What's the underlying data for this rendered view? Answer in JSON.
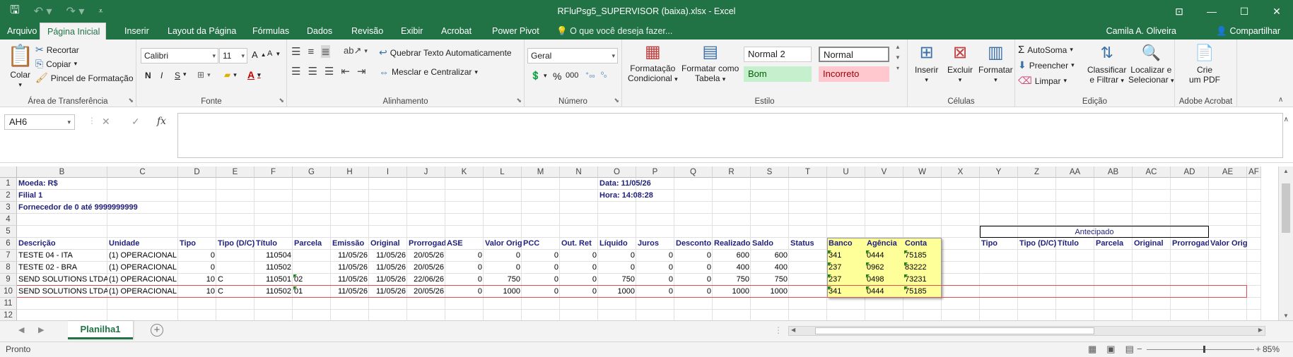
{
  "window": {
    "title": "RFluPsg5_SUPERVISOR (baixa).xlsx - Excel"
  },
  "qat": {
    "save_icon": "save-icon",
    "undo_icon": "undo-icon",
    "redo_icon": "redo-icon",
    "customize_icon": "customize-qat-icon"
  },
  "tabs": [
    "Arquivo",
    "Página Inicial",
    "Inserir",
    "Layout da Página",
    "Fórmulas",
    "Dados",
    "Revisão",
    "Exibir",
    "Acrobat",
    "Power Pivot"
  ],
  "active_tab": "Página Inicial",
  "tell_me": "O que você deseja fazer...",
  "user": "Camila A. Oliveira",
  "share": "Compartilhar",
  "ribbon": {
    "clipboard": {
      "label": "Área de Transferência",
      "paste": "Colar",
      "cut": "Recortar",
      "copy": "Copiar",
      "painter": "Pincel de Formatação"
    },
    "font": {
      "label": "Fonte",
      "name": "Calibri",
      "size": "11",
      "bold": "N",
      "italic": "I",
      "underline": "S"
    },
    "align": {
      "label": "Alinhamento",
      "wrap": "Quebrar Texto Automaticamente",
      "merge": "Mesclar e Centralizar"
    },
    "number": {
      "label": "Número",
      "format": "Geral",
      "percent": "%",
      "thousands": "000"
    },
    "styles": {
      "label": "Estilo",
      "conditional_l1": "Formatação",
      "conditional_l2": "Condicional",
      "table_l1": "Formatar como",
      "table_l2": "Tabela",
      "normal2": "Normal 2",
      "normal": "Normal",
      "good": "Bom",
      "bad": "Incorreto"
    },
    "cells": {
      "label": "Células",
      "insert": "Inserir",
      "delete": "Excluir",
      "format": "Formatar"
    },
    "editing": {
      "label": "Edição",
      "autosum": "AutoSoma",
      "fill": "Preencher",
      "clear": "Limpar",
      "sort_l1": "Classificar",
      "sort_l2": "e Filtrar",
      "find_l1": "Localizar e",
      "find_l2": "Selecionar"
    },
    "acrobat": {
      "label": "Adobe Acrobat",
      "pdf_l1": "Crie",
      "pdf_l2": "um PDF"
    }
  },
  "namebox": "AH6",
  "formula_value": "",
  "columns": [
    "B",
    "C",
    "D",
    "E",
    "F",
    "G",
    "H",
    "I",
    "J",
    "K",
    "L",
    "M",
    "N",
    "O",
    "P",
    "Q",
    "R",
    "S",
    "T",
    "U",
    "V",
    "W",
    "X",
    "Y",
    "Z",
    "AA",
    "AB",
    "AC",
    "AD",
    "AE",
    "AF"
  ],
  "rows": [
    "1",
    "2",
    "3",
    "4",
    "5",
    "6",
    "7",
    "8",
    "9",
    "10",
    "11",
    "12"
  ],
  "header_info": {
    "moeda": "Moeda: R$",
    "filial": "Filial 1",
    "fornecedor": "Fornecedor de 0 até 9999999999",
    "data": "Data: 11/05/26",
    "hora": "Hora: 14:08:28",
    "antecipado": "Antecipado"
  },
  "table_headers": [
    "Descrição",
    "Unidade",
    "Tipo",
    "Tipo (D/C)",
    "Título",
    "Parcela",
    "Emissão",
    "Original",
    "Prorrogado",
    "ASE",
    "Valor Orig",
    "PCC",
    "Out. Ret",
    "Líquido",
    "Juros",
    "Desconto",
    "Realizado",
    "Saldo",
    "Status",
    "Banco",
    "Agência",
    "Conta",
    "",
    "Tipo",
    "Tipo (D/C)",
    "Título",
    "Parcela",
    "Original",
    "Prorrogado",
    "Valor Original"
  ],
  "data_rows": [
    [
      "TESTE 04 - ITA",
      "(1) OPERACIONAL",
      "0",
      "",
      "110504",
      "",
      "11/05/26",
      "11/05/26",
      "20/05/26",
      "0",
      "0",
      "0",
      "0",
      "0",
      "0",
      "0",
      "600",
      "600",
      "",
      "341",
      "0444",
      "75185"
    ],
    [
      "TESTE 02 - BRA",
      "(1) OPERACIONAL",
      "0",
      "",
      "110502",
      "",
      "11/05/26",
      "11/05/26",
      "20/05/26",
      "0",
      "0",
      "0",
      "0",
      "0",
      "0",
      "0",
      "400",
      "400",
      "",
      "237",
      "0962",
      "83222"
    ],
    [
      "SEND SOLUTIONS LTDA",
      "(1) OPERACIONAL",
      "10",
      "C",
      "110501",
      "02",
      "11/05/26",
      "11/05/26",
      "22/06/26",
      "0",
      "750",
      "0",
      "0",
      "750",
      "0",
      "0",
      "750",
      "750",
      "",
      "237",
      "0498",
      "73231"
    ],
    [
      "SEND SOLUTIONS LTDA",
      "(1) OPERACIONAL",
      "10",
      "C",
      "110502",
      "01",
      "11/05/26",
      "11/05/26",
      "20/05/26",
      "0",
      "1000",
      "0",
      "0",
      "1000",
      "0",
      "0",
      "1000",
      "1000",
      "",
      "341",
      "0444",
      "75185"
    ]
  ],
  "sheet_tab": "Planilha1",
  "status": {
    "ready": "Pronto",
    "zoom": "85%"
  }
}
